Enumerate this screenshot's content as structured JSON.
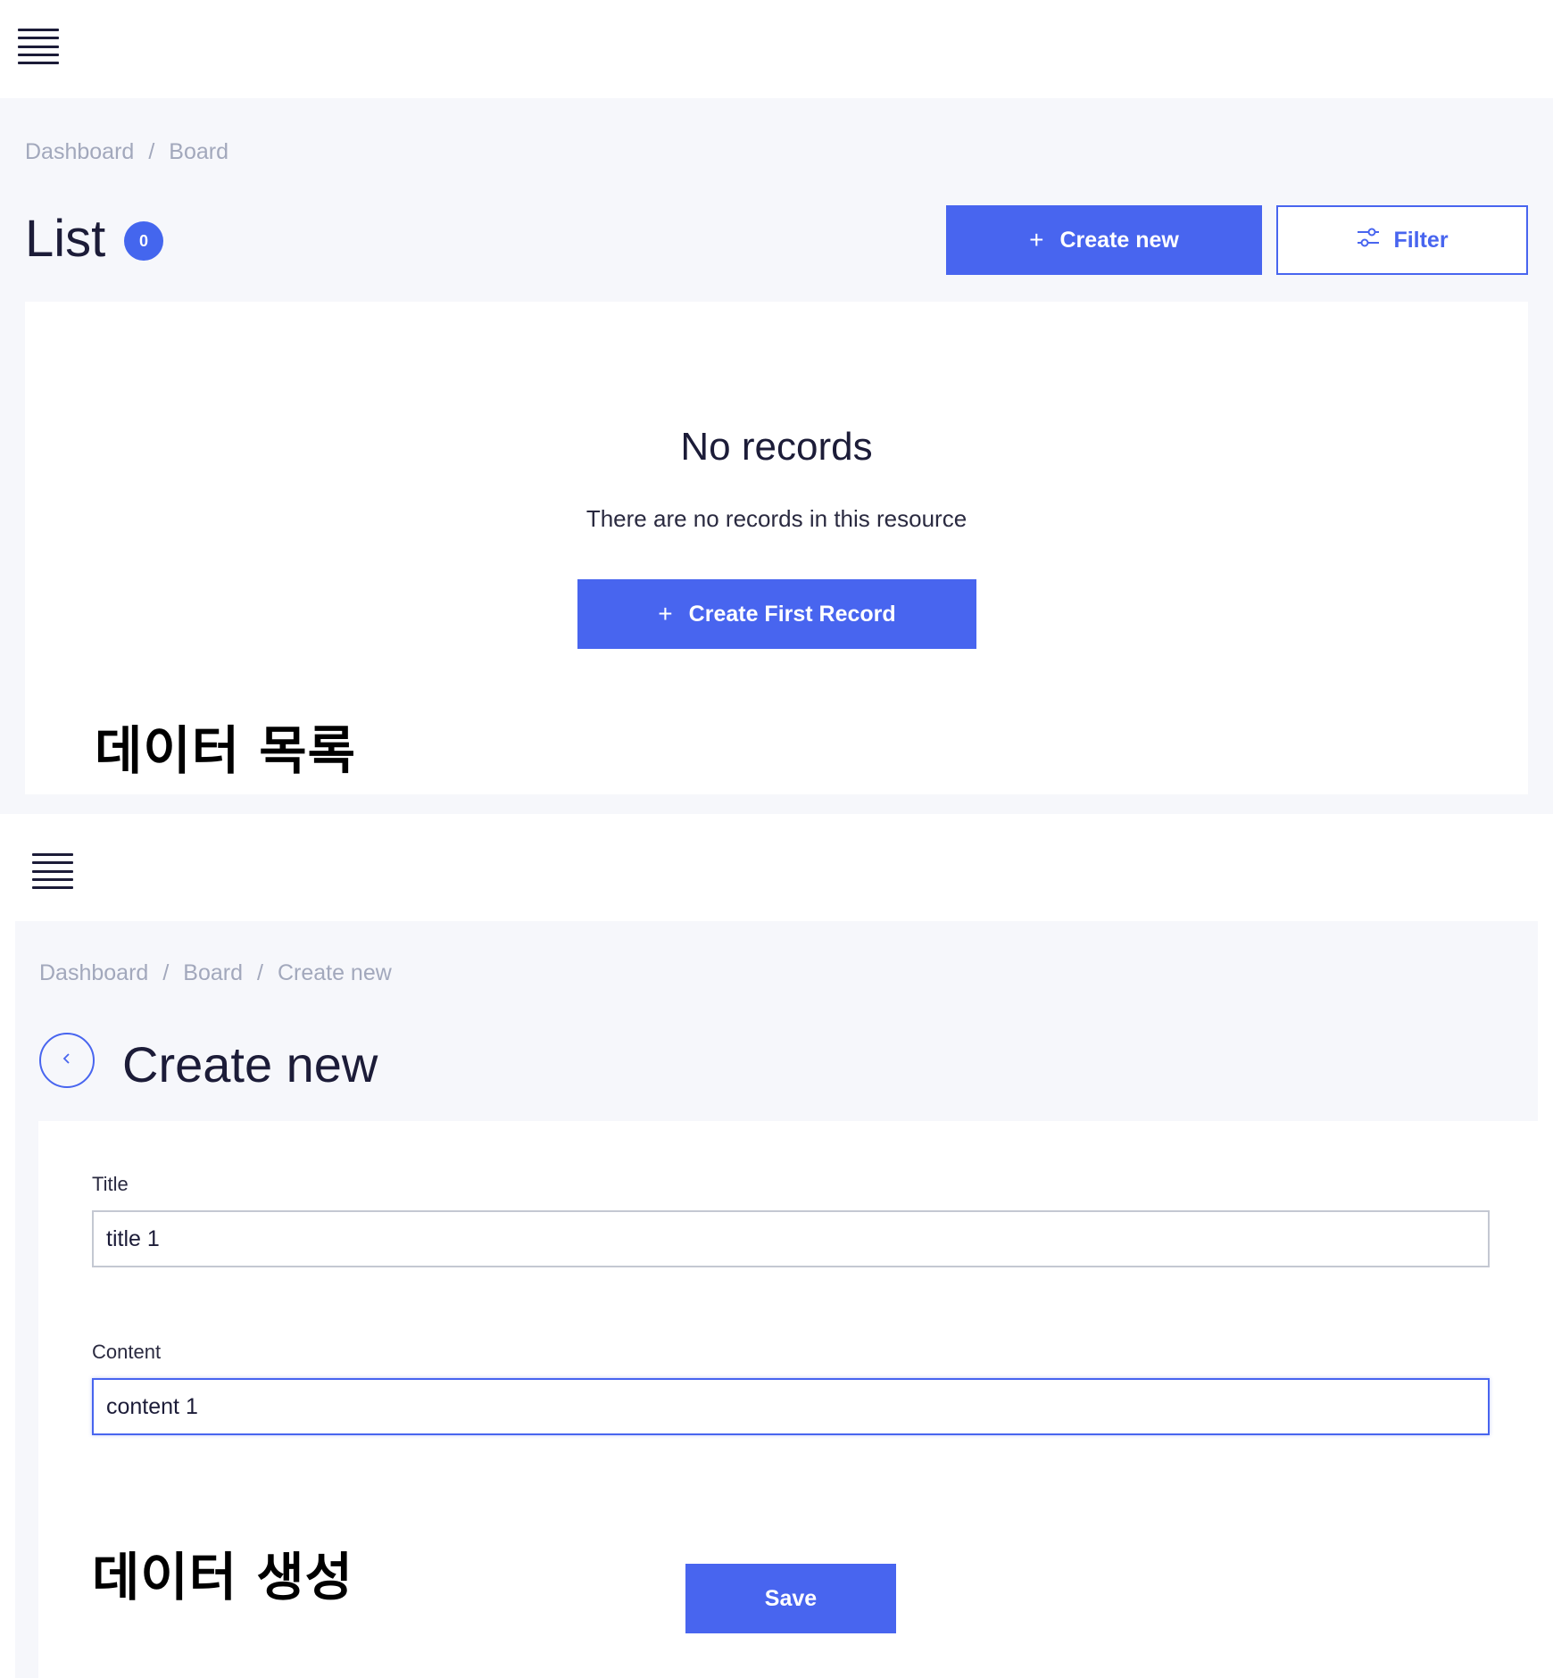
{
  "list_screen": {
    "breadcrumb": [
      "Dashboard",
      "Board"
    ],
    "title": "List",
    "record_count": "0",
    "create_button_label": "Create new",
    "filter_button_label": "Filter",
    "empty_state": {
      "title": "No records",
      "subtitle": "There are no records in this resource",
      "button_label": "Create First Record"
    },
    "caption": "데이터 목록"
  },
  "create_screen": {
    "breadcrumb": [
      "Dashboard",
      "Board",
      "Create new"
    ],
    "title": "Create new",
    "fields": [
      {
        "label": "Title",
        "value": "title 1"
      },
      {
        "label": "Content",
        "value": "content 1"
      }
    ],
    "save_button_label": "Save",
    "caption": "데이터 생성"
  },
  "colors": {
    "accent": "#4865ef",
    "background": "#f6f7fb",
    "breadcrumb_text": "#a2a8bc",
    "heading_text": "#1c1c38"
  },
  "icons": [
    "hamburger-menu-icon",
    "plus-icon",
    "filter-sliders-icon",
    "chevron-left-icon"
  ]
}
